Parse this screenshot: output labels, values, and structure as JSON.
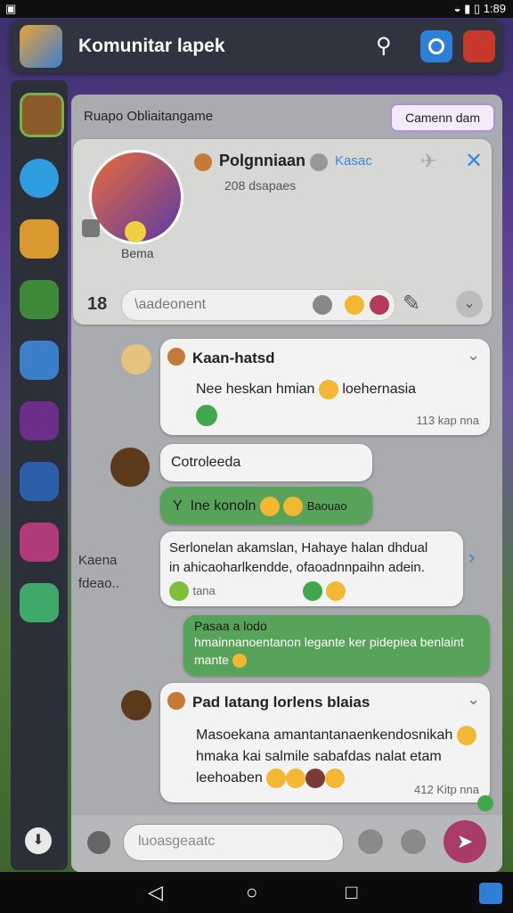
{
  "status": {
    "time": "1:89"
  },
  "header": {
    "title": "Komunitar lapek"
  },
  "panel": {
    "subtitle": "Ruapo Obliaitangame",
    "action_button": "Camenn dam"
  },
  "group_card": {
    "name": "Polgnniaan",
    "badge_text": "Kasac",
    "members_line": "208 dsapaes",
    "avatar_caption": "Bema",
    "input_placeholder": "\\aadeonent",
    "count_label": "18"
  },
  "messages": [
    {
      "author": "Kaan-hatsd",
      "text": "Nee heskan hmian",
      "text2": "loehernasia",
      "time": "113 kap nna"
    },
    {
      "author": "Cotroleeda",
      "green_prefix": "Y",
      "green_text": "Ine konoln",
      "green_suffix": "Baouao"
    },
    {
      "line1": "Serlonelan akamslan, Hahaye halan dhdual",
      "line2": "in ahicaoharlkendde, ofaoadnnpaihn adein.",
      "reaction_label": "tana"
    },
    {
      "line1": "Pasaa a lodo",
      "line2": "hmainnanoentanon legante ker pidepiea benlaint",
      "line3": "mante"
    },
    {
      "author": "Pad latang lorlens blaias",
      "line1": "Masoekana amantantanaenkendosnikah",
      "line2": "hmaka kai salmile sabafdas nalat etam",
      "line3": "leehoaben",
      "time": "412 Kitp nna"
    }
  ],
  "side_label": {
    "line1": "Kaena",
    "line2": "fdeao.."
  },
  "composer": {
    "placeholder": "luoasgeaatc"
  },
  "colors": {
    "accent_green": "#58a35a",
    "send_button": "#a83b6a",
    "link_blue": "#3a87d9"
  }
}
